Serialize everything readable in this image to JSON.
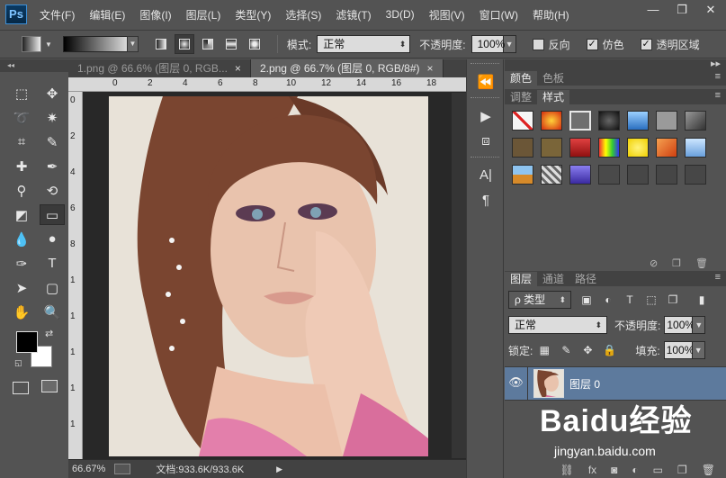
{
  "app": {
    "logo": "Ps"
  },
  "menu": [
    "文件(F)",
    "编辑(E)",
    "图像(I)",
    "图层(L)",
    "类型(Y)",
    "选择(S)",
    "滤镜(T)",
    "3D(D)",
    "视图(V)",
    "窗口(W)",
    "帮助(H)"
  ],
  "window_controls": {
    "minimize": "—",
    "restore": "❐",
    "close": "✕"
  },
  "options": {
    "mode_label": "模式:",
    "mode_value": "正常",
    "opacity_label": "不透明度:",
    "opacity_value": "100%",
    "reverse_label": "反向",
    "dither_label": "仿色",
    "transparency_label": "透明区域",
    "reverse_checked": false,
    "dither_checked": true,
    "transparency_checked": true
  },
  "tabs": [
    {
      "label": "1.png @ 66.6% (图层 0, RGB...",
      "close": "×"
    },
    {
      "label": "2.png @ 66.7% (图层 0, RGB/8#)",
      "close": "×"
    }
  ],
  "ruler": {
    "h": [
      "0",
      "2",
      "4",
      "6",
      "8",
      "10",
      "12",
      "14",
      "16",
      "18"
    ],
    "v": [
      "0",
      "2",
      "4",
      "6",
      "8",
      "1",
      "1",
      "1",
      "1",
      "1"
    ]
  },
  "status": {
    "zoom": "66.67%",
    "doc": "文档:933.6K/933.6K"
  },
  "color_panel": {
    "tabs": [
      "颜色",
      "色板"
    ]
  },
  "style_panel": {
    "tabs": [
      "调整",
      "样式"
    ]
  },
  "style_swatches": [
    {
      "name": "none",
      "color": "#f5f5f5"
    },
    {
      "name": "red-glow",
      "color": "#d42a0e"
    },
    {
      "name": "selected-frame",
      "color": "#6f6f6f"
    },
    {
      "name": "black-sphere",
      "color": "#1e1e1e"
    },
    {
      "name": "blue-glass",
      "color": "#3a7fd0"
    },
    {
      "name": "gray",
      "color": "#9a9a9a"
    },
    {
      "name": "dark-gray",
      "color": "#4a4a4a"
    },
    {
      "name": "brown",
      "color": "#6b5637"
    },
    {
      "name": "tan",
      "color": "#7a6539"
    },
    {
      "name": "red-bar",
      "color": "#b01818"
    },
    {
      "name": "multicolor",
      "color": "#7a3c9c"
    },
    {
      "name": "yellow",
      "color": "#f0d000"
    },
    {
      "name": "orange",
      "color": "#e07020"
    },
    {
      "name": "light-blue",
      "color": "#8ab8e6"
    },
    {
      "name": "landscape",
      "color": "#3f6fa0"
    },
    {
      "name": "pattern",
      "color": "#888888"
    },
    {
      "name": "purple-blue",
      "color": "#5a50c0"
    },
    {
      "name": "empty-1",
      "color": "#4a4a4a"
    },
    {
      "name": "empty-2",
      "color": "#474747"
    },
    {
      "name": "empty-3",
      "color": "#464646"
    },
    {
      "name": "empty-4",
      "color": "#474747"
    }
  ],
  "layers_panel": {
    "tabs": [
      "图层",
      "通道",
      "路径"
    ],
    "filter_label": "ρ 类型",
    "blend_mode": "正常",
    "opacity_label": "不透明度:",
    "opacity_value": "100%",
    "lock_label": "锁定:",
    "fill_label": "填充:",
    "fill_value": "100%",
    "layer_name": "图层 0"
  },
  "watermark": {
    "brand": "Baidu经验",
    "url": "jingyan.baidu.com"
  },
  "colors": {
    "accent": "#5d7a9d",
    "panel": "#535353",
    "dark": "#282828"
  }
}
